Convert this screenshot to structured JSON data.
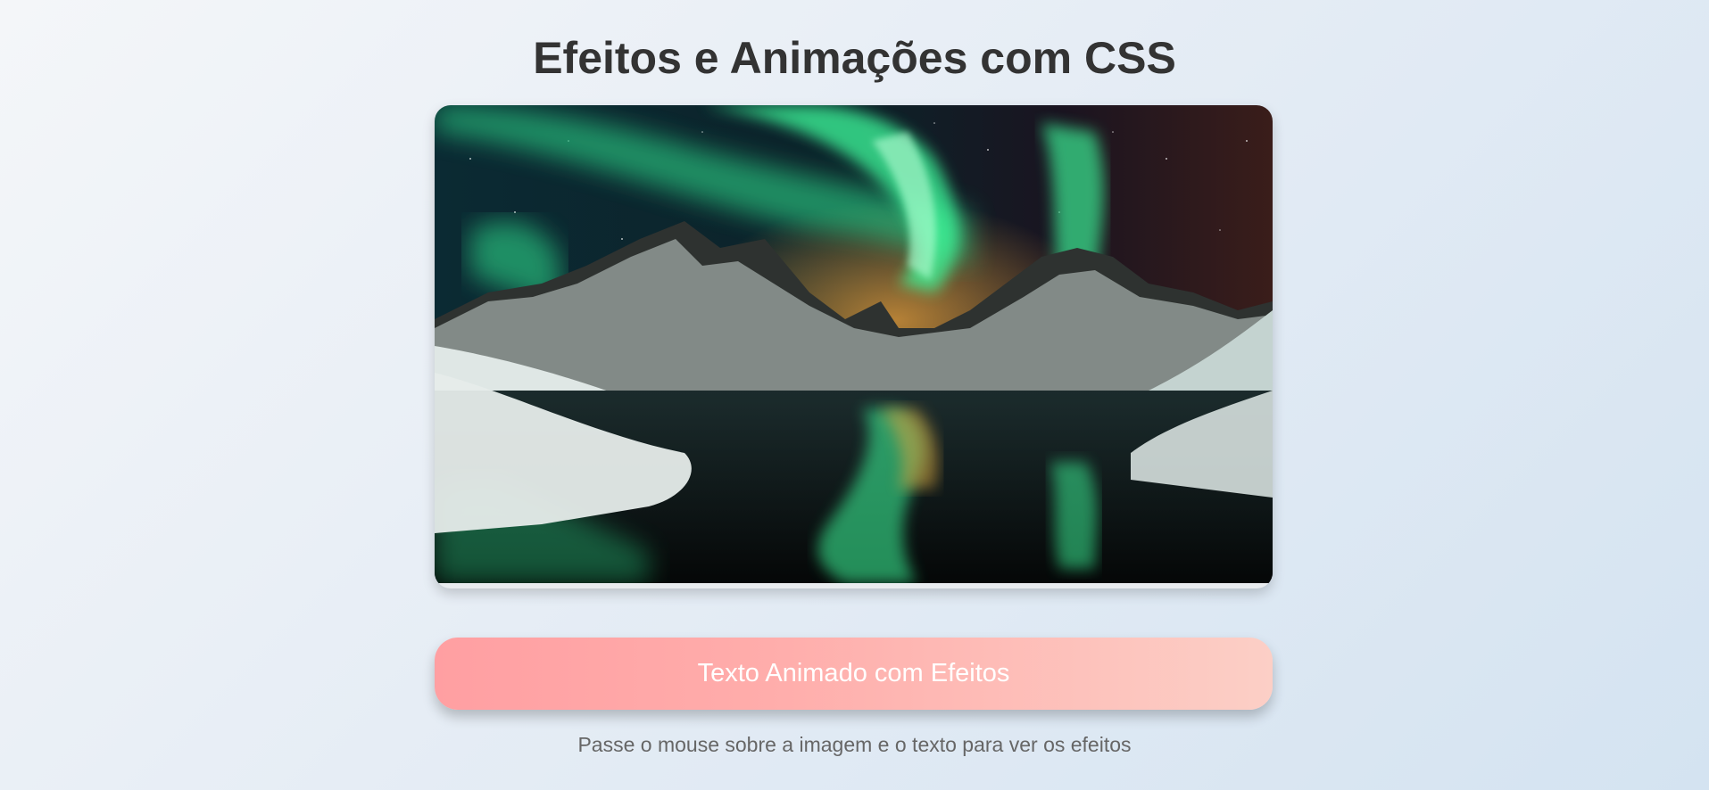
{
  "header": {
    "title": "Efeitos e Animações com CSS"
  },
  "image": {
    "description_icon": "aurora-landscape-image"
  },
  "banner": {
    "label": "Texto Animado com Efeitos"
  },
  "hint": {
    "text": "Passe o mouse sobre a imagem e o texto para ver os efeitos"
  },
  "colors": {
    "title": "#333333",
    "banner_start": "#ff9fa2",
    "banner_end": "#fccfc6",
    "hint": "#666666",
    "aurora_green": "#3dfc9c"
  }
}
